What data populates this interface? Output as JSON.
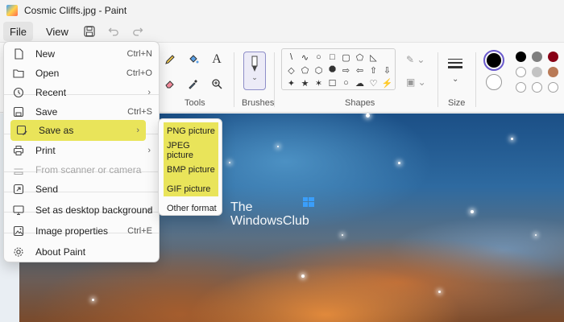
{
  "window": {
    "title": "Cosmic Cliffs.jpg - Paint"
  },
  "menubar": {
    "file": "File",
    "view": "View",
    "save_icon": "save-icon",
    "undo_icon": "undo-icon",
    "redo_icon": "redo-icon"
  },
  "ribbon": {
    "tools_label": "Tools",
    "brushes_label": "Brushes",
    "shapes_label": "Shapes",
    "size_label": "Size",
    "text_tool": "A",
    "shapes": [
      "\\",
      "∿",
      "○",
      "□",
      "▢",
      "⬠",
      "◺",
      "",
      "◇",
      "⬠",
      "⬡",
      "⯃",
      "⇨",
      "⇦",
      "⇧",
      "⇩",
      "✦",
      "★",
      "✶",
      "☐",
      "○",
      "☁",
      "♡",
      "⚡"
    ],
    "palette": {
      "row1": [
        "#000000",
        "#7f7f7f",
        "#880015",
        "#ed1c24"
      ],
      "row2": [
        "#ffffff",
        "#c3c3c3",
        "#b97a57",
        "#ffaec9"
      ],
      "row3": [
        "#ffffff",
        "#ffffff",
        "#ffffff",
        "#ffffff"
      ]
    },
    "primary_color": "#000000",
    "secondary_color": "#ffffff"
  },
  "file_menu": {
    "items": [
      {
        "label": "New",
        "shortcut": "Ctrl+N",
        "icon": "new-file-icon"
      },
      {
        "label": "Open",
        "shortcut": "Ctrl+O",
        "icon": "folder-icon"
      },
      {
        "label": "Recent",
        "shortcut": "",
        "icon": "clock-icon",
        "arrow": true
      },
      {
        "label": "Save",
        "shortcut": "Ctrl+S",
        "icon": "save-icon"
      },
      {
        "label": "Save as",
        "shortcut": "",
        "icon": "save-as-icon",
        "arrow": true,
        "highlighted": true
      },
      {
        "label": "Print",
        "shortcut": "",
        "icon": "print-icon",
        "arrow": true
      },
      {
        "label": "From scanner or camera",
        "shortcut": "",
        "icon": "scanner-icon",
        "disabled": true
      },
      {
        "label": "Send",
        "shortcut": "",
        "icon": "send-icon"
      },
      {
        "label": "Set as desktop background",
        "shortcut": "",
        "icon": "desktop-icon",
        "arrow": true
      },
      {
        "label": "Image properties",
        "shortcut": "Ctrl+E",
        "icon": "image-icon"
      },
      {
        "label": "About Paint",
        "shortcut": "",
        "icon": "gear-icon"
      }
    ]
  },
  "save_as_submenu": {
    "items": [
      "PNG picture",
      "JPEG picture",
      "BMP picture",
      "GIF picture",
      "Other format"
    ]
  },
  "watermark": {
    "line1": "The",
    "line2": "WindowsClub"
  }
}
